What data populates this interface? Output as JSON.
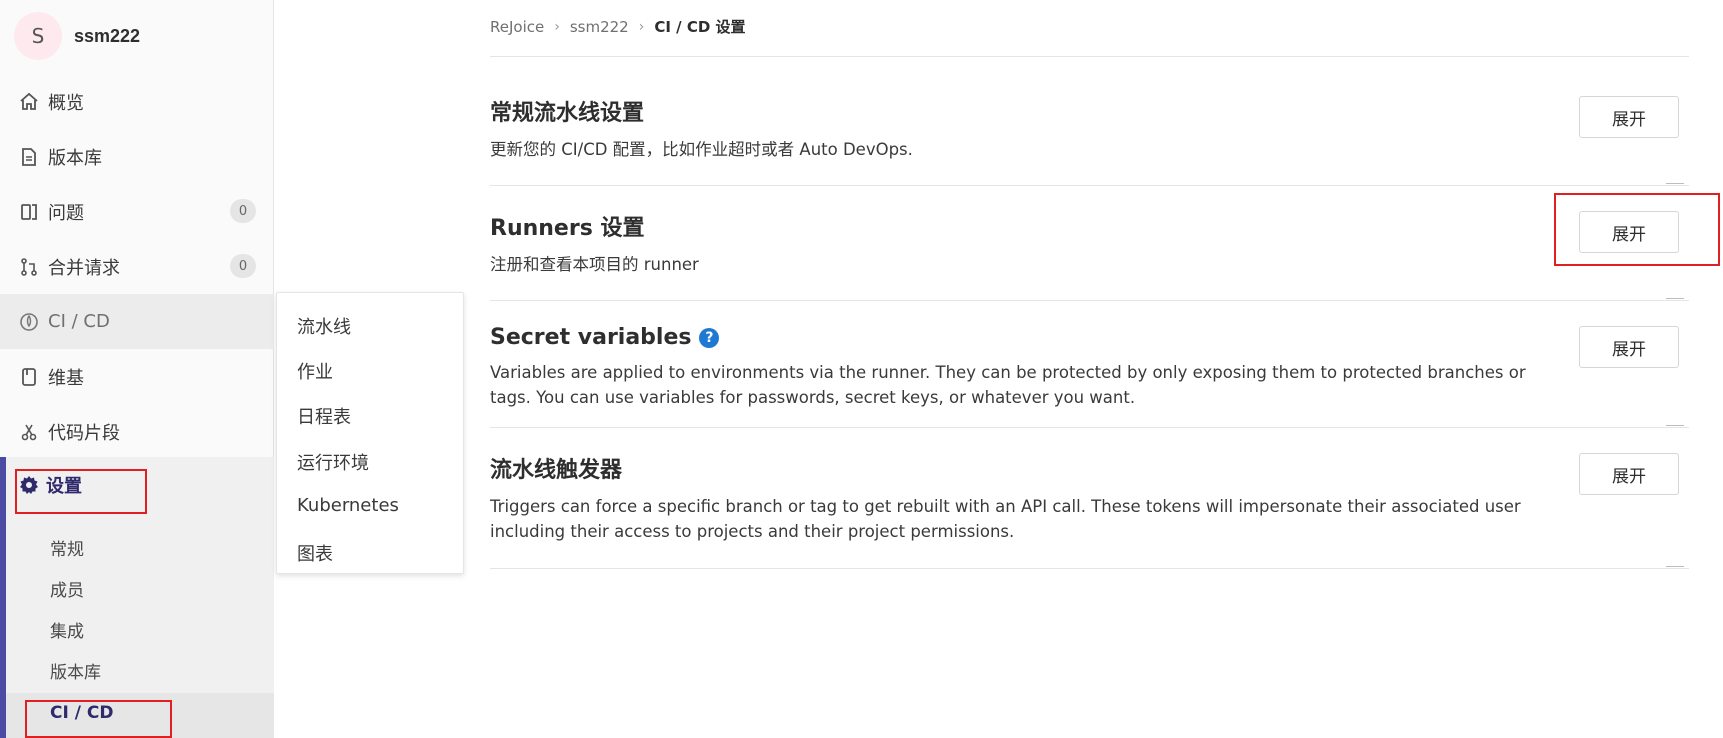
{
  "project": {
    "avatar_letter": "S",
    "name": "ssm222"
  },
  "sidebar": {
    "items": [
      {
        "label": "概览",
        "icon": "home-icon"
      },
      {
        "label": "版本库",
        "icon": "doc-icon"
      },
      {
        "label": "问题",
        "icon": "issues-icon",
        "badge": "0"
      },
      {
        "label": "合并请求",
        "icon": "merge-request-icon",
        "badge": "0"
      },
      {
        "label": "CI / CD",
        "icon": "rocket-icon"
      },
      {
        "label": "维基",
        "icon": "book-icon"
      },
      {
        "label": "代码片段",
        "icon": "scissors-icon"
      }
    ],
    "settings": {
      "label": "设置",
      "icon": "gear-icon",
      "sub_items": [
        "常规",
        "成员",
        "集成",
        "版本库",
        "CI / CD"
      ]
    }
  },
  "flyout": {
    "items": [
      "流水线",
      "作业",
      "日程表",
      "运行环境",
      "Kubernetes",
      "图表"
    ]
  },
  "breadcrumb": {
    "items": [
      "ReJoice",
      "ssm222"
    ],
    "current": "CI / CD 设置"
  },
  "sections": [
    {
      "title": "常规流水线设置",
      "desc": "更新您的 CI/CD 配置，比如作业超时或者 Auto DevOps.",
      "button": "展开"
    },
    {
      "title": "Runners 设置",
      "desc": "注册和查看本项目的 runner",
      "button": "展开"
    },
    {
      "title": "Secret variables",
      "help": "?",
      "desc": "Variables are applied to environments via the runner. They can be protected by only exposing them to protected branches or tags. You can use variables for passwords, secret keys, or whatever you want.",
      "button": "展开"
    },
    {
      "title": "流水线触发器",
      "desc": "Triggers can force a specific branch or tag to get rebuilt with an API call. These tokens will impersonate their associated user including their access to projects and their project permissions.",
      "button": "展开"
    }
  ],
  "colors": {
    "accent": "#4b4ba3",
    "highlight_box": "#e02020",
    "help_blue": "#1f78d1"
  }
}
